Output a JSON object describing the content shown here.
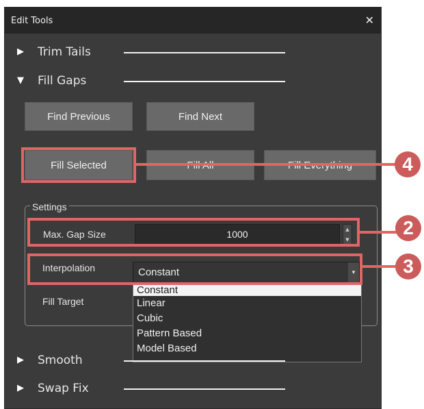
{
  "window": {
    "title": "Edit Tools",
    "close_glyph": "✕"
  },
  "sections": {
    "trim_tails": {
      "label": "Trim Tails",
      "arrow": "▶"
    },
    "fill_gaps": {
      "label": "Fill Gaps",
      "arrow": "▼"
    },
    "smooth": {
      "label": "Smooth",
      "arrow": "▶"
    },
    "swap_fix": {
      "label": "Swap Fix",
      "arrow": "▶"
    }
  },
  "buttons": {
    "find_previous": "Find Previous",
    "find_next": "Find Next",
    "fill_selected": "Fill Selected",
    "fill_all": "Fill All",
    "fill_everything": "Fill Everything"
  },
  "settings": {
    "legend": "Settings",
    "max_gap_size": {
      "label": "Max. Gap Size",
      "value": "1000"
    },
    "interpolation": {
      "label": "Interpolation",
      "value": "Constant",
      "options": [
        "Constant",
        "Linear",
        "Cubic",
        "Pattern Based",
        "Model Based"
      ]
    },
    "fill_target": {
      "label": "Fill Target"
    }
  },
  "annotations": {
    "badge_4": "4",
    "badge_2": "2",
    "badge_3": "3",
    "color": "#e06666"
  }
}
